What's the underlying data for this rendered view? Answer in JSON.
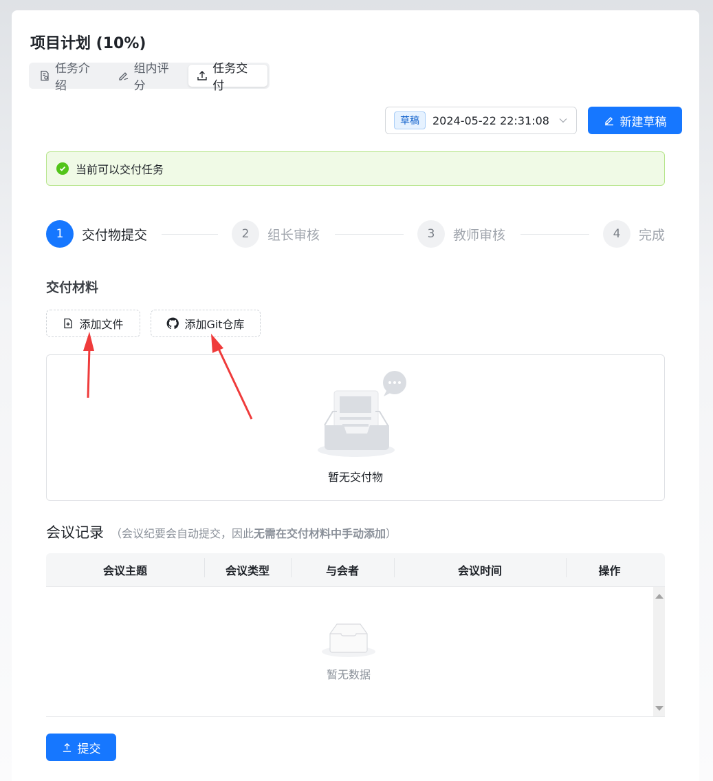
{
  "header": {
    "title": "项目计划 (10%)"
  },
  "tabs": [
    {
      "label": "任务介绍",
      "icon": "document-icon"
    },
    {
      "label": "组内评分",
      "icon": "pen-icon"
    },
    {
      "label": "任务交付",
      "icon": "upload-icon",
      "active": true
    }
  ],
  "version": {
    "badge": "草稿",
    "value": "2024-05-22 22:31:08"
  },
  "toolbar": {
    "new_draft_label": "新建草稿"
  },
  "alert": {
    "text": "当前可以交付任务"
  },
  "steps": [
    {
      "num": "1",
      "label": "交付物提交",
      "status": "active"
    },
    {
      "num": "2",
      "label": "组长审核",
      "status": "wait"
    },
    {
      "num": "3",
      "label": "教师审核",
      "status": "wait"
    },
    {
      "num": "4",
      "label": "完成",
      "status": "wait"
    }
  ],
  "deliverables": {
    "title": "交付材料",
    "add_file_label": "添加文件",
    "add_git_label": "添加Git仓库",
    "empty_text": "暂无交付物"
  },
  "meetings": {
    "title": "会议记录",
    "note_prefix": "（会议纪要会自动提交，因此",
    "note_bold": "无需在交付材料中手动添加",
    "note_suffix": "）",
    "columns": [
      "会议主题",
      "会议类型",
      "与会者",
      "会议时间",
      "操作"
    ],
    "empty_text": "暂无数据"
  },
  "footer": {
    "submit_label": "提交"
  },
  "colors": {
    "primary": "#1677ff",
    "success": "#52c41a",
    "annotation": "#ef3b3b"
  }
}
